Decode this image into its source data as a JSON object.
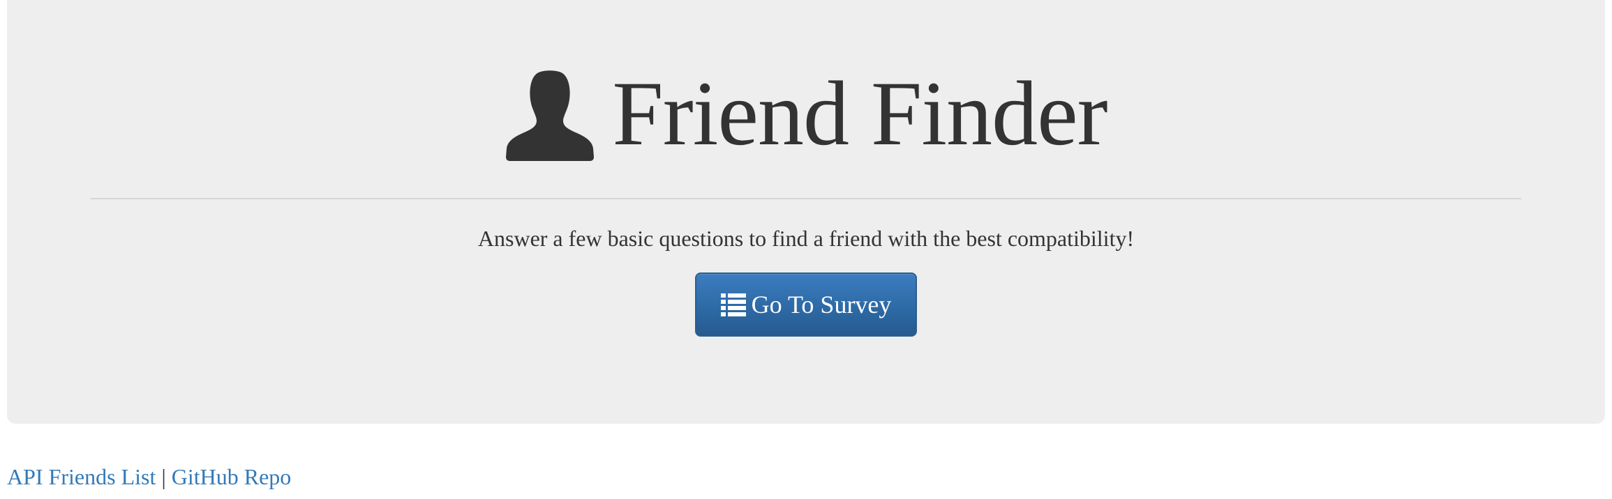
{
  "header": {
    "icon": "user-icon",
    "title": "Friend Finder"
  },
  "main": {
    "tagline": "Answer a few basic questions to find a friend with the best compatibility!",
    "survey_button": {
      "icon": "list-icon",
      "label": "Go To Survey"
    }
  },
  "footer": {
    "links": [
      {
        "label": "API Friends List"
      },
      {
        "label": "GitHub Repo"
      }
    ],
    "separator": "|"
  },
  "colors": {
    "jumbotron_bg": "#eeeeee",
    "button_bg": "#2d6aa6",
    "link": "#337ab7",
    "text": "#333333"
  }
}
